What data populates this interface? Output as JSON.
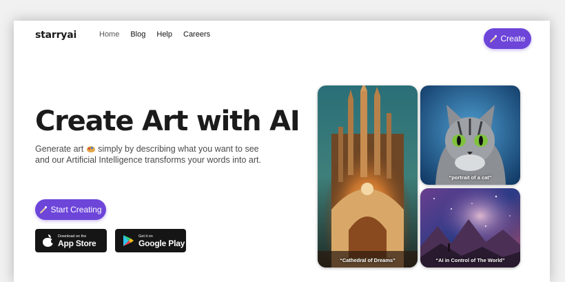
{
  "header": {
    "logo": "starryai",
    "nav": [
      "Home",
      "Blog",
      "Help",
      "Careers"
    ],
    "create_label": "Create"
  },
  "hero": {
    "title": "Create Art with AI",
    "description_line1_a": "Generate art",
    "description_line1_b": "simply by describing what you want to see",
    "description_line2": "and our Artificial Intelligence transforms your words into art.",
    "start_label": "Start Creating"
  },
  "stores": {
    "apple": {
      "small": "Download on the",
      "big": "App Store"
    },
    "google": {
      "small": "Get it on",
      "big": "Google Play"
    }
  },
  "gallery": {
    "cathedral_caption": "“Cathedral of Dreams”",
    "cat_caption": "“portrait of a cat”",
    "space_caption": "“AI in Control of The World”"
  },
  "colors": {
    "accent": "#6d45d9",
    "text": "#1b1b1b",
    "store_bg": "#151515"
  },
  "icons": [
    "magic-wand-icon",
    "palette-emoji-icon",
    "apple-icon",
    "google-play-icon"
  ]
}
